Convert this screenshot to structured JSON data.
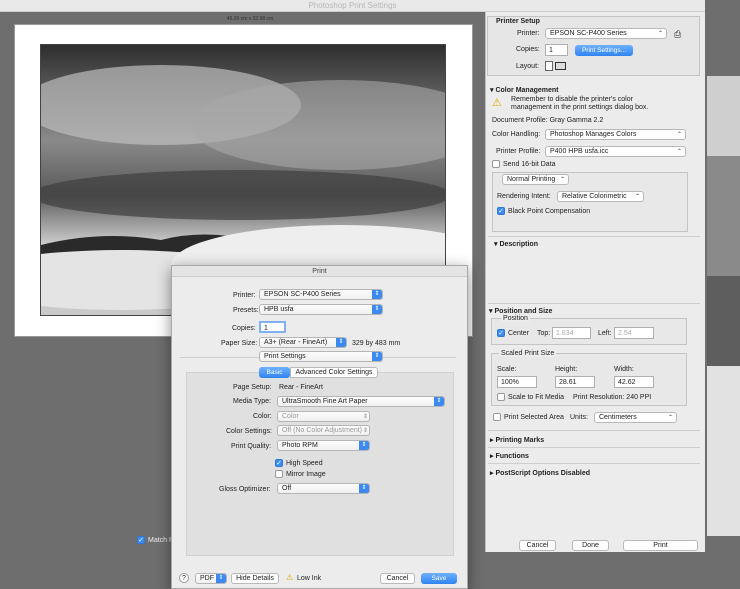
{
  "window": {
    "title": "Photoshop Print Settings",
    "size_label": "49.26 cm x 32.98 cm"
  },
  "bottom_bar": {
    "match_label": "Match P",
    "cancel": "Cancel",
    "done": "Done",
    "print": "Print"
  },
  "printer_setup": {
    "header": "Printer Setup",
    "printer_label": "Printer:",
    "printer_value": "EPSON SC-P400 Series",
    "copies_label": "Copies:",
    "copies_value": "1",
    "print_settings_btn": "Print Settings...",
    "layout_label": "Layout:"
  },
  "color_management": {
    "header": "Color Management",
    "warning": "Remember to disable the printer's color management in the print settings dialog box.",
    "doc_profile": "Document Profile: Gray Gamma 2.2",
    "handling_label": "Color Handling:",
    "handling_value": "Photoshop Manages Colors",
    "profile_label": "Printer Profile:",
    "profile_value": "P400 HPB usfa.icc",
    "send16": "Send 16-bit Data",
    "normal_printing": "Normal Printing",
    "intent_label": "Rendering Intent:",
    "intent_value": "Relative Colorimetric",
    "bpc": "Black Point Compensation"
  },
  "description": {
    "header": "Description"
  },
  "position_size": {
    "header": "Position and Size",
    "position_label": "Position",
    "center": "Center",
    "top_label": "Top:",
    "top_value": "1.834",
    "left_label": "Left:",
    "left_value": "2.54",
    "scaled_label": "Scaled Print Size",
    "scale_label": "Scale:",
    "scale_value": "100%",
    "height_label": "Height:",
    "height_value": "28.61",
    "width_label": "Width:",
    "width_value": "42.62",
    "fit_media": "Scale to Fit Media",
    "resolution": "Print Resolution: 240 PPI",
    "print_selected": "Print Selected Area",
    "units_label": "Units:",
    "units_value": "Centimeters"
  },
  "sections": {
    "marks": "Printing Marks",
    "functions": "Functions",
    "postscript": "PostScript Options Disabled"
  },
  "dialog": {
    "title": "Print",
    "printer_label": "Printer:",
    "printer_value": "EPSON SC-P400 Series",
    "presets_label": "Presets:",
    "presets_value": "HPB usfa",
    "copies_label": "Copies:",
    "copies_value": "1",
    "paper_label": "Paper Size:",
    "paper_value": "A3+ (Rear - FineArt)",
    "paper_dims": "329 by 483 mm",
    "panel_value": "Print Settings",
    "tab_basic": "Basic",
    "tab_advanced": "Advanced Color Settings",
    "page_setup_label": "Page Setup:",
    "page_setup_value": "Rear - FineArt",
    "media_label": "Media Type:",
    "media_value": "UltraSmooth Fine Art Paper",
    "color_label": "Color:",
    "color_value": "Color",
    "color_settings_label": "Color Settings:",
    "color_settings_value": "Off (No Color Adjustment)",
    "quality_label": "Print Quality:",
    "quality_value": "Photo RPM",
    "high_speed": "High Speed",
    "mirror": "Mirror Image",
    "gloss_label": "Gloss Optimizer:",
    "gloss_value": "Off",
    "help": "?",
    "pdf": "PDF",
    "hide_details": "Hide Details",
    "low_ink": "Low Ink",
    "cancel": "Cancel",
    "save": "Save"
  }
}
